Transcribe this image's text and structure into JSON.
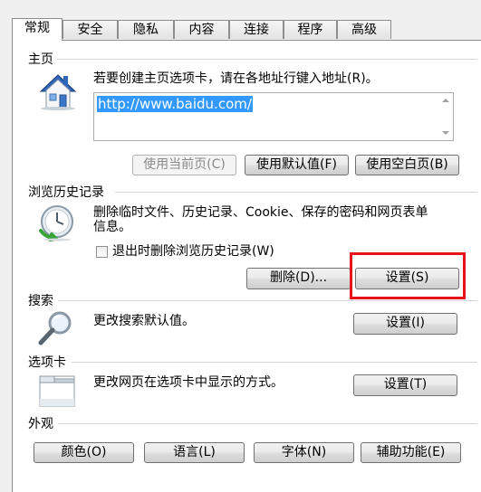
{
  "tabs": [
    {
      "label": "常规",
      "active": true
    },
    {
      "label": "安全",
      "active": false
    },
    {
      "label": "隐私",
      "active": false
    },
    {
      "label": "内容",
      "active": false
    },
    {
      "label": "连接",
      "active": false
    },
    {
      "label": "程序",
      "active": false
    },
    {
      "label": "高级",
      "active": false
    }
  ],
  "homepage": {
    "title": "主页",
    "instruction": "若要创建主页选项卡，请在各地址行键入地址(R)。",
    "url": "http://www.baidu.com/",
    "use_current_label": "使用当前页(C)",
    "use_default_label": "使用默认值(F)",
    "use_blank_label": "使用空白页(B)"
  },
  "history": {
    "title": "浏览历史记录",
    "description_line1": "删除临时文件、历史记录、Cookie、保存的密码和网页表单",
    "description_line2": "信息。",
    "checkbox_label": "退出时删除浏览历史记录(W)",
    "delete_label": "删除(D)...",
    "settings_label": "设置(S)"
  },
  "search": {
    "title": "搜索",
    "description": "更改搜索默认值。",
    "settings_label": "设置(I)"
  },
  "tabs_section": {
    "title": "选项卡",
    "description": "更改网页在选项卡中显示的方式。",
    "settings_label": "设置(T)"
  },
  "appearance": {
    "title": "外观",
    "colors_label": "颜色(O)",
    "languages_label": "语言(L)",
    "fonts_label": "字体(N)",
    "accessibility_label": "辅助功能(E)"
  },
  "colors": {
    "highlight": "#e8131a",
    "selection": "#3399ff"
  }
}
